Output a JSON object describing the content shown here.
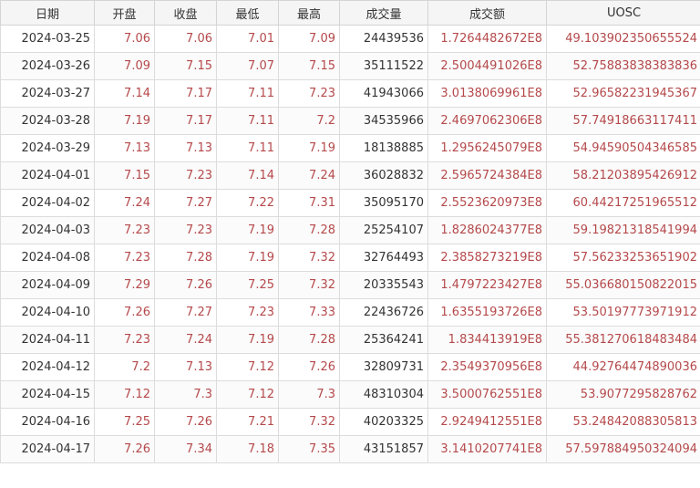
{
  "columns": [
    "日期",
    "开盘",
    "收盘",
    "最低",
    "最高",
    "成交量",
    "成交额",
    "UOSC"
  ],
  "rows": [
    [
      "2024-03-25",
      "7.06",
      "7.06",
      "7.01",
      "7.09",
      "24439536",
      "1.7264482672E8",
      "49.103902350655524"
    ],
    [
      "2024-03-26",
      "7.09",
      "7.15",
      "7.07",
      "7.15",
      "35111522",
      "2.5004491026E8",
      "52.75883838383836"
    ],
    [
      "2024-03-27",
      "7.14",
      "7.17",
      "7.11",
      "7.23",
      "41943066",
      "3.0138069961E8",
      "52.96582231945367"
    ],
    [
      "2024-03-28",
      "7.19",
      "7.17",
      "7.11",
      "7.2",
      "34535966",
      "2.4697062306E8",
      "57.74918663117411"
    ],
    [
      "2024-03-29",
      "7.13",
      "7.13",
      "7.11",
      "7.19",
      "18138885",
      "1.2956245079E8",
      "54.94590504346585"
    ],
    [
      "2024-04-01",
      "7.15",
      "7.23",
      "7.14",
      "7.24",
      "36028832",
      "2.5965724384E8",
      "58.21203895426912"
    ],
    [
      "2024-04-02",
      "7.24",
      "7.27",
      "7.22",
      "7.31",
      "35095170",
      "2.5523620973E8",
      "60.44217251965512"
    ],
    [
      "2024-04-03",
      "7.23",
      "7.23",
      "7.19",
      "7.28",
      "25254107",
      "1.8286024377E8",
      "59.19821318541994"
    ],
    [
      "2024-04-08",
      "7.23",
      "7.28",
      "7.19",
      "7.32",
      "32764493",
      "2.3858273219E8",
      "57.56233253651902"
    ],
    [
      "2024-04-09",
      "7.29",
      "7.26",
      "7.25",
      "7.32",
      "20335543",
      "1.4797223427E8",
      "55.036680150822015"
    ],
    [
      "2024-04-10",
      "7.26",
      "7.27",
      "7.23",
      "7.33",
      "22436726",
      "1.6355193726E8",
      "53.50197773971912"
    ],
    [
      "2024-04-11",
      "7.23",
      "7.24",
      "7.19",
      "7.28",
      "25364241",
      "1.834413919E8",
      "55.381270618483484"
    ],
    [
      "2024-04-12",
      "7.2",
      "7.13",
      "7.12",
      "7.26",
      "32809731",
      "2.3549370956E8",
      "44.92764474890036"
    ],
    [
      "2024-04-15",
      "7.12",
      "7.3",
      "7.12",
      "7.3",
      "48310304",
      "3.5000762551E8",
      "53.9077295828762"
    ],
    [
      "2024-04-16",
      "7.25",
      "7.26",
      "7.21",
      "7.32",
      "40203325",
      "2.9249412551E8",
      "53.24842088305813"
    ],
    [
      "2024-04-17",
      "7.26",
      "7.34",
      "7.18",
      "7.35",
      "43151857",
      "3.1410207741E8",
      "57.597884950324094"
    ]
  ]
}
